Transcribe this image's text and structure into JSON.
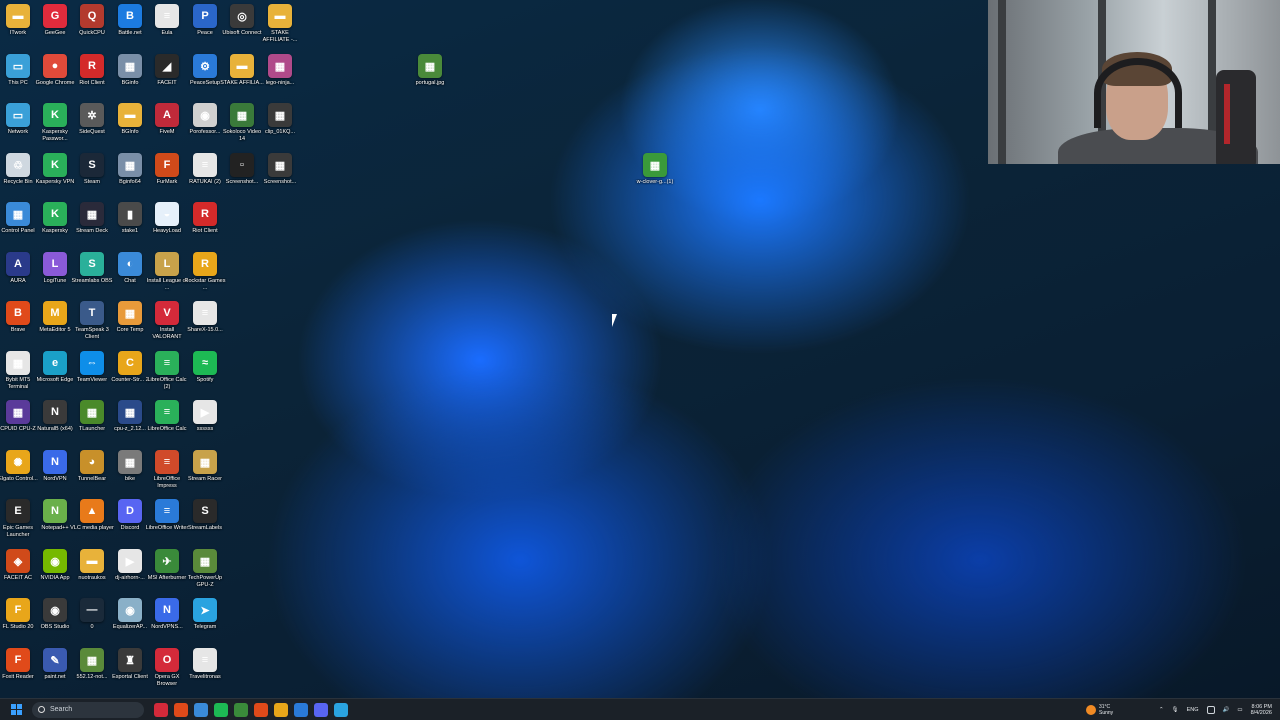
{
  "desktop_icons": [
    {
      "label": "ITwork",
      "color": "#e8b23a",
      "glyph": "▬"
    },
    {
      "label": "GeeGee",
      "color": "#e02b3c",
      "glyph": "G"
    },
    {
      "label": "QuickCPU",
      "color": "#b33a2e",
      "glyph": "Q"
    },
    {
      "label": "Battle.net",
      "color": "#1c7be0",
      "glyph": "B"
    },
    {
      "label": "Eula",
      "color": "#e6e6e6",
      "glyph": "≡"
    },
    {
      "label": "Peace",
      "color": "#2a66c9",
      "glyph": "P"
    },
    {
      "label": "Ubisoft Connect",
      "color": "#3a3a3a",
      "glyph": "◎"
    },
    {
      "label": "STAKE AFFILIATE -...",
      "color": "#e8b23a",
      "glyph": "▬"
    },
    {
      "label": "This PC",
      "color": "#3aa0d8",
      "glyph": "▭"
    },
    {
      "label": "Google Chrome",
      "color": "#e04a3a",
      "glyph": "●"
    },
    {
      "label": "Riot Client",
      "color": "#d42a2a",
      "glyph": "R"
    },
    {
      "label": "BGinfo",
      "color": "#7a8fa8",
      "glyph": "▦"
    },
    {
      "label": "FACEIT",
      "color": "#2a2a2a",
      "glyph": "◢"
    },
    {
      "label": "PeaceSetup",
      "color": "#2a7ad8",
      "glyph": "⚙"
    },
    {
      "label": "STAKE AFFILIA...",
      "color": "#e8b23a",
      "glyph": "▬"
    },
    {
      "label": "lego-ninja...",
      "color": "#b04a8a",
      "glyph": "▦"
    },
    {
      "label": "Network",
      "color": "#3aa0d8",
      "glyph": "▭"
    },
    {
      "label": "Kaspersky Passwor...",
      "color": "#2ab05a",
      "glyph": "K"
    },
    {
      "label": "SideQuest",
      "color": "#5a5a5a",
      "glyph": "✲"
    },
    {
      "label": "BGInfo",
      "color": "#e8b23a",
      "glyph": "▬"
    },
    {
      "label": "FiveM",
      "color": "#c02a3a",
      "glyph": "A"
    },
    {
      "label": "Porofessor...",
      "color": "#d0d0d0",
      "glyph": "◉"
    },
    {
      "label": "Sokoloco Video 14",
      "color": "#3a7a3a",
      "glyph": "▦"
    },
    {
      "label": "clip_01KQ...",
      "color": "#3a3a3a",
      "glyph": "▦"
    },
    {
      "label": "Recycle Bin",
      "color": "#cfd8e0",
      "glyph": "♲"
    },
    {
      "label": "Kaspersky VPN",
      "color": "#2ab05a",
      "glyph": "K"
    },
    {
      "label": "Steam",
      "color": "#1b2838",
      "glyph": "S"
    },
    {
      "label": "Bginfo64",
      "color": "#7a8fa8",
      "glyph": "▦"
    },
    {
      "label": "FurMark",
      "color": "#d04a1a",
      "glyph": "F"
    },
    {
      "label": "RATUKAI (2)",
      "color": "#e6e6e6",
      "glyph": "≡"
    },
    {
      "label": "Screenshot...",
      "color": "#222",
      "glyph": "▫"
    },
    {
      "label": "Screenshot...",
      "color": "#3a3a3a",
      "glyph": "▦"
    },
    {
      "label": "Control Panel",
      "color": "#3a8ad8",
      "glyph": "▦"
    },
    {
      "label": "Kaspersky",
      "color": "#2ab05a",
      "glyph": "K"
    },
    {
      "label": "Stream Deck",
      "color": "#2a2a3a",
      "glyph": "▦"
    },
    {
      "label": "stake1",
      "color": "#4a4a4a",
      "glyph": "▮"
    },
    {
      "label": "HeavyLoad",
      "color": "#e6f0fa",
      "glyph": "◒"
    },
    {
      "label": "Riot Client",
      "color": "#d42a2a",
      "glyph": "R"
    },
    {
      "label": "AURA",
      "color": "#2a3a8a",
      "glyph": "A"
    },
    {
      "label": "LogiTune",
      "color": "#8a5ad8",
      "glyph": "L"
    },
    {
      "label": "Streamlabs OBS",
      "color": "#2ab09a",
      "glyph": "S"
    },
    {
      "label": "Chat",
      "color": "#3a8ad8",
      "glyph": "◐"
    },
    {
      "label": "Install League of ...",
      "color": "#c8a24a",
      "glyph": "L"
    },
    {
      "label": "Rockstar Games ...",
      "color": "#e8a61a",
      "glyph": "R"
    },
    {
      "label": "Brave",
      "color": "#e04a1a",
      "glyph": "B"
    },
    {
      "label": "MetaEditor 5",
      "color": "#e8a61a",
      "glyph": "M"
    },
    {
      "label": "TeamSpeak 3 Client",
      "color": "#3a5a8a",
      "glyph": "T"
    },
    {
      "label": "Core Temp",
      "color": "#e89a3a",
      "glyph": "▦"
    },
    {
      "label": "Install VALORANT",
      "color": "#d42a3a",
      "glyph": "V"
    },
    {
      "label": "ShareX-15.0...",
      "color": "#e6e6e6",
      "glyph": "≡"
    },
    {
      "label": "Bybit MT5 Terminal",
      "color": "#e6e6e6",
      "glyph": "▦"
    },
    {
      "label": "Microsoft Edge",
      "color": "#1aa0c8",
      "glyph": "e"
    },
    {
      "label": "TeamViewer",
      "color": "#0e8ee9",
      "glyph": "⇔"
    },
    {
      "label": "Counter-Str... 2",
      "color": "#e8a61a",
      "glyph": "C"
    },
    {
      "label": "LibreOffice Calc (2)",
      "color": "#2ab05a",
      "glyph": "≡"
    },
    {
      "label": "Spotify",
      "color": "#1db954",
      "glyph": "≈"
    },
    {
      "label": "CPUID CPU-Z",
      "color": "#5a3a9a",
      "glyph": "▦"
    },
    {
      "label": "NaturalB (x64)",
      "color": "#3a3a3a",
      "glyph": "N"
    },
    {
      "label": "TLauncher",
      "color": "#4a8a2a",
      "glyph": "▦"
    },
    {
      "label": "cpu-z_2.12...",
      "color": "#2a4a8a",
      "glyph": "▦"
    },
    {
      "label": "LibreOffice Calc",
      "color": "#2ab05a",
      "glyph": "≡"
    },
    {
      "label": "ssssss",
      "color": "#e6e6e6",
      "glyph": "▶"
    },
    {
      "label": "Elgato Control...",
      "color": "#e8a61a",
      "glyph": "✺"
    },
    {
      "label": "NordVPN",
      "color": "#3a6ae8",
      "glyph": "N"
    },
    {
      "label": "TunnelBear",
      "color": "#c8902a",
      "glyph": "◕"
    },
    {
      "label": "bike",
      "color": "#7a7a7a",
      "glyph": "▦"
    },
    {
      "label": "LibreOffice Impress",
      "color": "#d04a2a",
      "glyph": "≡"
    },
    {
      "label": "Stream Racer",
      "color": "#c8a24a",
      "glyph": "▦"
    },
    {
      "label": "Epic Games Launcher",
      "color": "#2a2a2a",
      "glyph": "E"
    },
    {
      "label": "Notepad++",
      "color": "#6ab04a",
      "glyph": "N"
    },
    {
      "label": "VLC media player",
      "color": "#e87a1a",
      "glyph": "▲"
    },
    {
      "label": "Discord",
      "color": "#5865f2",
      "glyph": "D"
    },
    {
      "label": "LibreOffice Writer",
      "color": "#2a7ad8",
      "glyph": "≡"
    },
    {
      "label": "StreamLabels",
      "color": "#2a2a2a",
      "glyph": "S"
    },
    {
      "label": "FACEIT AC",
      "color": "#d04a1a",
      "glyph": "◈"
    },
    {
      "label": "NVIDIA App",
      "color": "#76b900",
      "glyph": "◉"
    },
    {
      "label": "nuotraukos",
      "color": "#e8b23a",
      "glyph": "▬"
    },
    {
      "label": "dj-airhorn-...",
      "color": "#e6e6e6",
      "glyph": "▶"
    },
    {
      "label": "MSI Afterburner",
      "color": "#3a8a3a",
      "glyph": "✈"
    },
    {
      "label": "TechPowerUp GPU-Z",
      "color": "#5a8a3a",
      "glyph": "▦"
    },
    {
      "label": "FL Studio 20",
      "color": "#e8a61a",
      "glyph": "F"
    },
    {
      "label": "OBS Studio",
      "color": "#3a3a3a",
      "glyph": "◉"
    },
    {
      "label": "0",
      "color": "#1a2a3a",
      "glyph": "—"
    },
    {
      "label": "EqualizerAP...",
      "color": "#8ab0c8",
      "glyph": "◉"
    },
    {
      "label": "NordVPNS...",
      "color": "#3a6ae8",
      "glyph": "N"
    },
    {
      "label": "Telegram",
      "color": "#2aa3e0",
      "glyph": "➤"
    },
    {
      "label": "Foxit Reader",
      "color": "#e04a1a",
      "glyph": "F"
    },
    {
      "label": "paint.net",
      "color": "#3a5ab0",
      "glyph": "✎"
    },
    {
      "label": "552.12-not...",
      "color": "#5a8a3a",
      "glyph": "▦"
    },
    {
      "label": "Esportal Client",
      "color": "#3a3a3a",
      "glyph": "♜"
    },
    {
      "label": "Opera GX Browser",
      "color": "#d42a3a",
      "glyph": "O"
    },
    {
      "label": "Travelitronas",
      "color": "#e6e6e6",
      "glyph": "≡"
    }
  ],
  "floating_icons": [
    {
      "label": "portugal.jpg",
      "color": "#4a8a3a",
      "glyph": "▦"
    },
    {
      "label": "w-clover-g...(1)",
      "color": "#3a9a3a",
      "glyph": "▦"
    }
  ],
  "taskbar": {
    "search_placeholder": "Search",
    "apps": [
      "#d42a3a",
      "#e04a1a",
      "#3a8ad8",
      "#1db954",
      "#3a8a3a",
      "#e04a1a",
      "#e8a61a",
      "#2a7ad8",
      "#5865f2",
      "#2aa3e0"
    ]
  },
  "tray": {
    "weather_temp": "31°C",
    "weather_desc": "Sunny",
    "language": "ENG",
    "time": "8:06 PM",
    "date": "8/4/2026"
  }
}
